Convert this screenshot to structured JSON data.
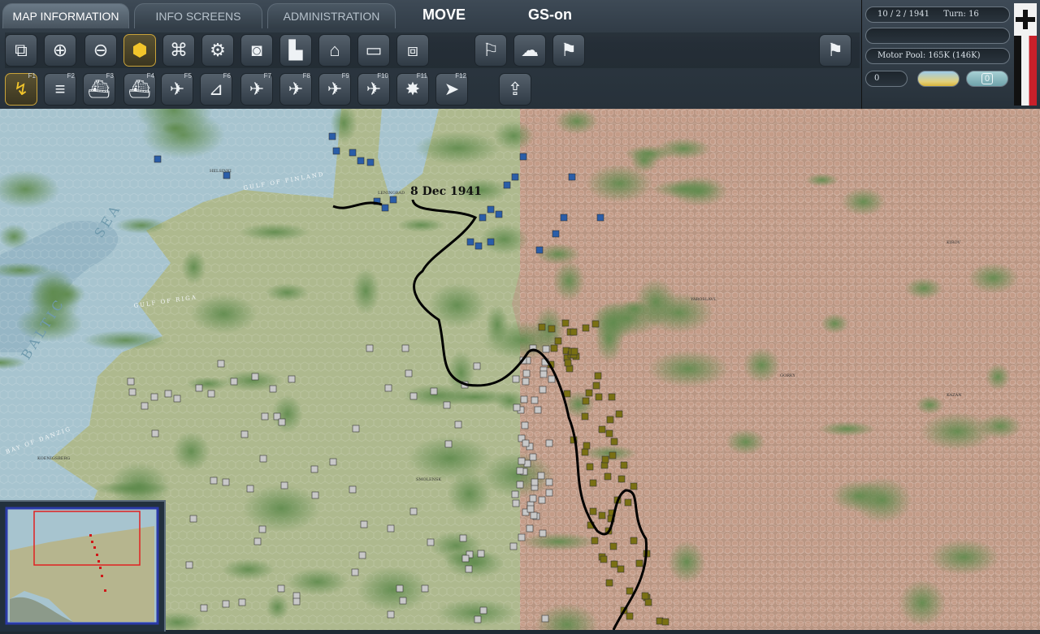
{
  "tabs": [
    {
      "label": "MAP INFORMATION",
      "active": true
    },
    {
      "label": "INFO SCREENS",
      "active": false
    },
    {
      "label": "ADMINISTRATION",
      "active": false
    }
  ],
  "mode_label": "MOVE",
  "gs_label": "GS-on",
  "toolbar_row1": [
    {
      "name": "overlay-icon",
      "glyph": "⧉"
    },
    {
      "name": "zoom-in-icon",
      "glyph": "⊕"
    },
    {
      "name": "zoom-out-icon",
      "glyph": "⊖"
    },
    {
      "name": "hex-grid-icon",
      "glyph": "⬢",
      "selected": true
    },
    {
      "name": "unit-display-icon",
      "glyph": "⌘"
    },
    {
      "name": "settings-gear-icon",
      "glyph": "⚙"
    },
    {
      "name": "unit-circle-icon",
      "glyph": "◙"
    },
    {
      "name": "supply-icon",
      "glyph": "▙"
    },
    {
      "name": "factory-icon",
      "glyph": "⌂"
    },
    {
      "name": "blank-box-icon",
      "glyph": "▭"
    },
    {
      "name": "unit-stack-icon",
      "glyph": "⧈"
    },
    {
      "name": "flag-arrow-icon",
      "glyph": "⚐"
    },
    {
      "name": "weather-icon",
      "glyph": "☁"
    },
    {
      "name": "flag-outline-icon",
      "glyph": "⚑"
    },
    {
      "name": "surrender-flags-icon",
      "glyph": "⚑"
    }
  ],
  "toolbar_row2": [
    {
      "name": "ground-move-icon",
      "glyph": "↯",
      "key": "F1",
      "selected": true
    },
    {
      "name": "rail-move-icon",
      "glyph": "≡",
      "key": "F2"
    },
    {
      "name": "naval-transport-icon",
      "glyph": "⛴",
      "key": "F3"
    },
    {
      "name": "naval-invasion-icon",
      "glyph": "⛴",
      "key": "F4"
    },
    {
      "name": "air-recon-icon",
      "glyph": "✈",
      "key": "F5"
    },
    {
      "name": "artillery-icon",
      "glyph": "⊿",
      "key": "F6"
    },
    {
      "name": "air-interdiction-icon",
      "glyph": "✈",
      "key": "F7"
    },
    {
      "name": "ground-attack-icon",
      "glyph": "✈",
      "key": "F8"
    },
    {
      "name": "paradrop-icon",
      "glyph": "✈",
      "key": "F9"
    },
    {
      "name": "air-transfer-icon",
      "glyph": "✈",
      "key": "F10"
    },
    {
      "name": "bomb-icon",
      "glyph": "✸",
      "key": "F11"
    },
    {
      "name": "next-unit-icon",
      "glyph": "➤",
      "key": "F12"
    },
    {
      "name": "upload-icon",
      "glyph": "⇪",
      "key": ""
    }
  ],
  "status": {
    "date": "10 / 2 / 1941",
    "turn": "Turn: 16",
    "motor_pool": "Motor Pool:  165K (146K)",
    "counter_value": "0",
    "weather_counter": "0"
  },
  "map": {
    "front_line_label": "8 Dec 1941",
    "sea_labels": [
      "SEA",
      "GULF OF FINLAND",
      "GULF OF RIGA",
      "BALTIC",
      "BAY OF DANZIG"
    ],
    "city_labels": [
      "HELSINKI",
      "KOENIGSBERG",
      "SMOLENSK",
      "LENINGRAD",
      "KIROV",
      "YAROSLAVL",
      "KAZAN",
      "GORKY"
    ],
    "colors": {
      "sea": "#a7c4cf",
      "land_west": "#aeb98e",
      "land_east": "#b99683",
      "german_unit": "#c8c8c8",
      "soviet_unit": "#7a7013",
      "finnish_unit": "#2a5da8",
      "front_line": "#000000"
    }
  }
}
